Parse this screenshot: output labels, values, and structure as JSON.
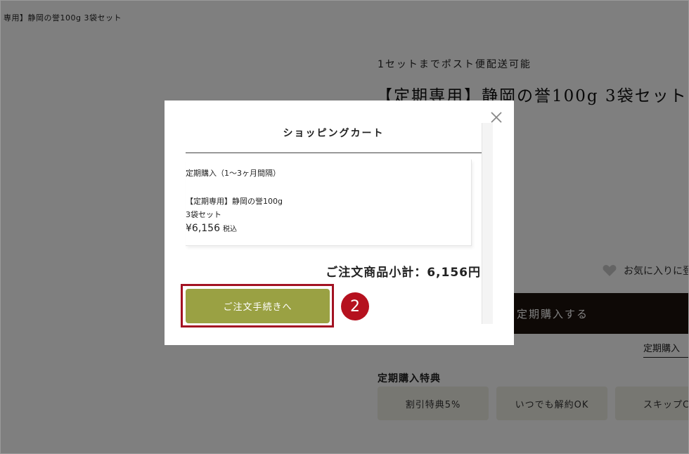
{
  "page": {
    "breadcrumb": "専用】静岡の誉100g 3袋セット",
    "shipping_note": "1セットまでポスト便配送可能",
    "product_title": "【定期専用】静岡の誉100g 3袋セット",
    "favorite_label": "お気に入りに登",
    "subscribe_button": "定期購入する",
    "subscribe_link": "定期購入",
    "benefits_heading": "定期購入特典",
    "benefits": [
      "割引特典5%",
      "いつでも解約OK",
      "スキップC"
    ]
  },
  "modal": {
    "title": "ショッピングカート",
    "item": {
      "plan": "定期購入（1〜3ヶ月間隔）",
      "name": "【定期専用】静岡の誉100g 3袋セット",
      "price": "¥6,156",
      "tax_label": "税込"
    },
    "subtotal": "ご注文商品小計：6,156円",
    "checkout_button": "ご注文手続きへ",
    "step_number": "2"
  },
  "colors": {
    "checkout_green": "#9aa143",
    "highlight_red": "#a31222",
    "subscribe_dark": "#1d120c"
  },
  "icons": [
    "close-icon",
    "heart-icon"
  ]
}
